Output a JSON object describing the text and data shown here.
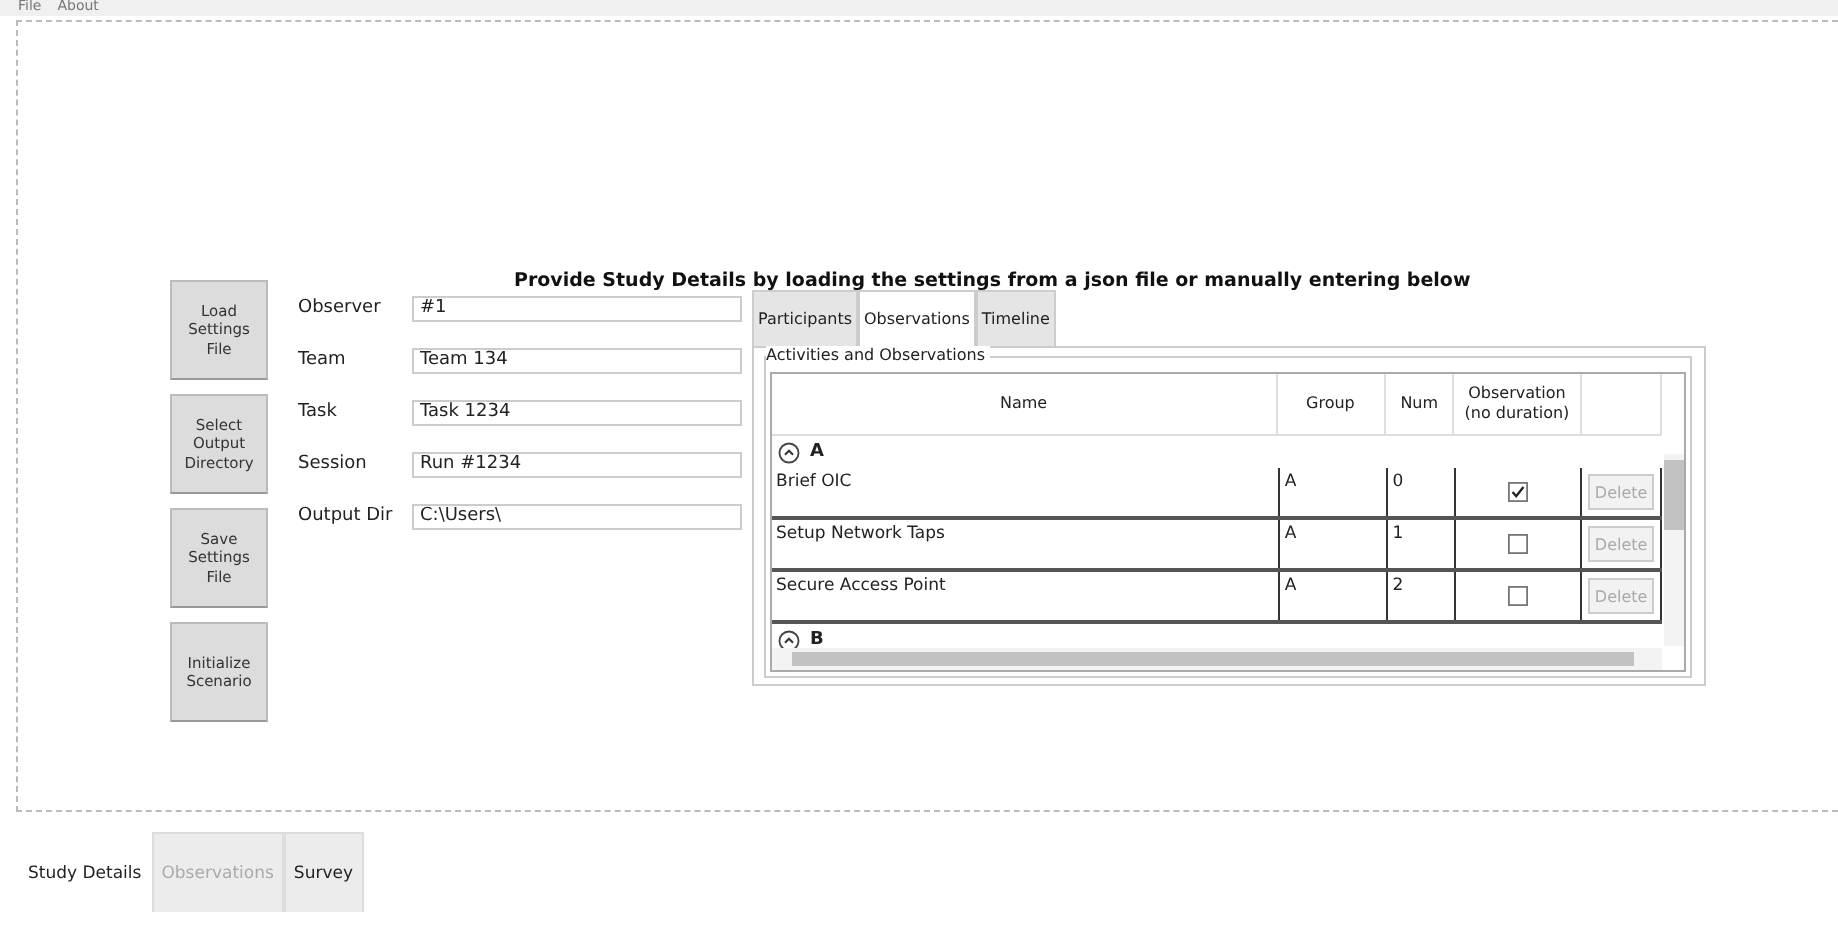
{
  "menu": [
    "File",
    "About"
  ],
  "heading": "Provide Study Details by loading the settings from a json file or manually entering below",
  "buttons": [
    "Load Settings File",
    "Select Output Directory",
    "Save Settings File",
    "Initialize Scenario"
  ],
  "fields": [
    {
      "label": "Observer",
      "value": "#1"
    },
    {
      "label": "Team",
      "value": "Team 134"
    },
    {
      "label": "Task",
      "value": "Task 1234"
    },
    {
      "label": "Session",
      "value": "Run #1234"
    },
    {
      "label": "Output Dir",
      "value": "C:\\Users\\"
    }
  ],
  "inner_tabs": [
    {
      "label": "Participants",
      "selected": false
    },
    {
      "label": "Observations",
      "selected": true
    },
    {
      "label": "Timeline",
      "selected": false
    }
  ],
  "group_box": {
    "title": "Activities and Observations",
    "columns": [
      "Name",
      "Group",
      "Num",
      "Observation (no duration)"
    ],
    "groups": [
      {
        "name": "A",
        "expanded": true,
        "rows": [
          {
            "name": "Brief OIC",
            "group": "A",
            "num": "0",
            "observation": true,
            "action": "Delete"
          },
          {
            "name": "Setup Network Taps",
            "group": "A",
            "num": "1",
            "observation": false,
            "action": "Delete"
          },
          {
            "name": "Secure Access Point",
            "group": "A",
            "num": "2",
            "observation": false,
            "action": "Delete"
          }
        ]
      },
      {
        "name": "B",
        "expanded": true
      }
    ]
  },
  "bottom_tabs": [
    {
      "label": "Study Details",
      "selected": true,
      "disabled": false
    },
    {
      "label": "Observations",
      "selected": false,
      "disabled": true
    },
    {
      "label": "Survey",
      "selected": false,
      "disabled": false
    }
  ]
}
